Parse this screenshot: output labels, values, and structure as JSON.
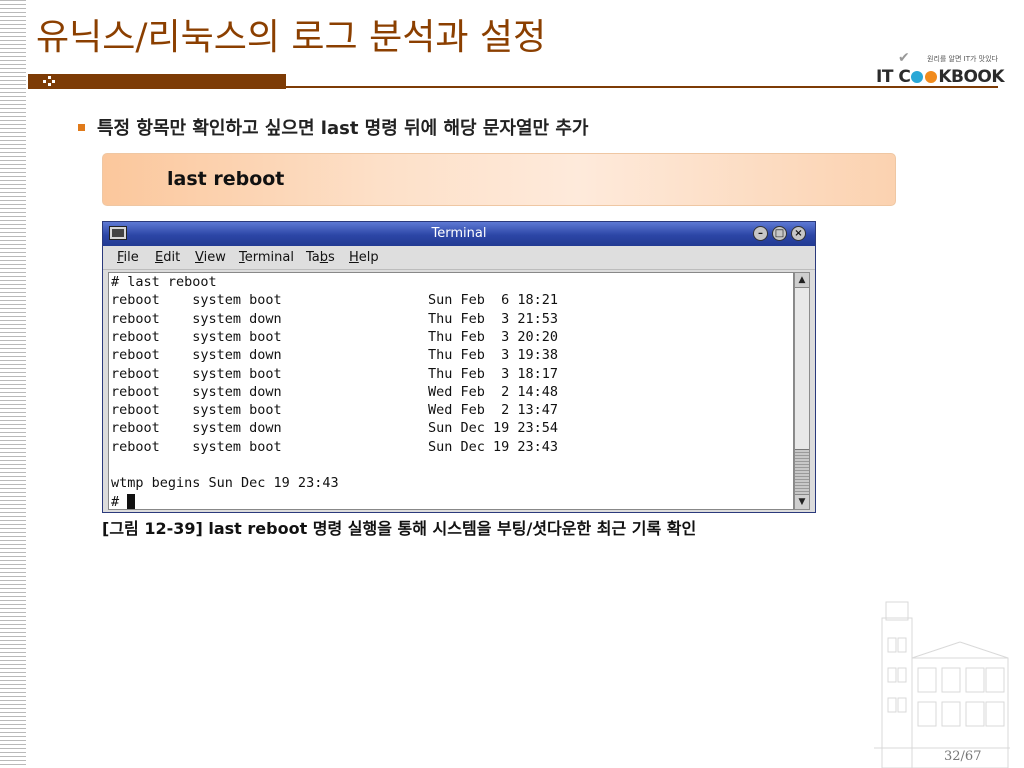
{
  "slide": {
    "title": "유닉스/리눅스의 로그 분석과 설정",
    "bullet": "특정 항목만 확인하고 싶으면 last 명령 뒤에 해당 문자열만 추가",
    "command_box": "last reboot",
    "caption": "[그림 12-39] last reboot 명령 실행을 통해 시스템을 부팅/셧다운한 최근 기록 확인",
    "page_number": "32/67",
    "accent_color": "#7d3b05"
  },
  "logo": {
    "tagline": "원리를 알면 IT가 맛있다",
    "text_prefix": "IT C",
    "text_suffix": "KBOOK",
    "dot_colors": [
      "#29a7d6",
      "#f18b1d"
    ]
  },
  "terminal": {
    "title": "Terminal",
    "menu": [
      {
        "label": "File",
        "mnemonic": "F"
      },
      {
        "label": "Edit",
        "mnemonic": "E"
      },
      {
        "label": "View",
        "mnemonic": "V"
      },
      {
        "label": "Terminal",
        "mnemonic": "T"
      },
      {
        "label": "Tabs",
        "mnemonic": "b"
      },
      {
        "label": "Help",
        "mnemonic": "H"
      }
    ],
    "lines": [
      "# last reboot",
      "reboot    system boot                  Sun Feb  6 18:21",
      "reboot    system down                  Thu Feb  3 21:53",
      "reboot    system boot                  Thu Feb  3 20:20",
      "reboot    system down                  Thu Feb  3 19:38",
      "reboot    system boot                  Thu Feb  3 18:17",
      "reboot    system down                  Wed Feb  2 14:48",
      "reboot    system boot                  Wed Feb  2 13:47",
      "reboot    system down                  Sun Dec 19 23:54",
      "reboot    system boot                  Sun Dec 19 23:43",
      "",
      "wtmp begins Sun Dec 19 23:43",
      "# "
    ]
  }
}
